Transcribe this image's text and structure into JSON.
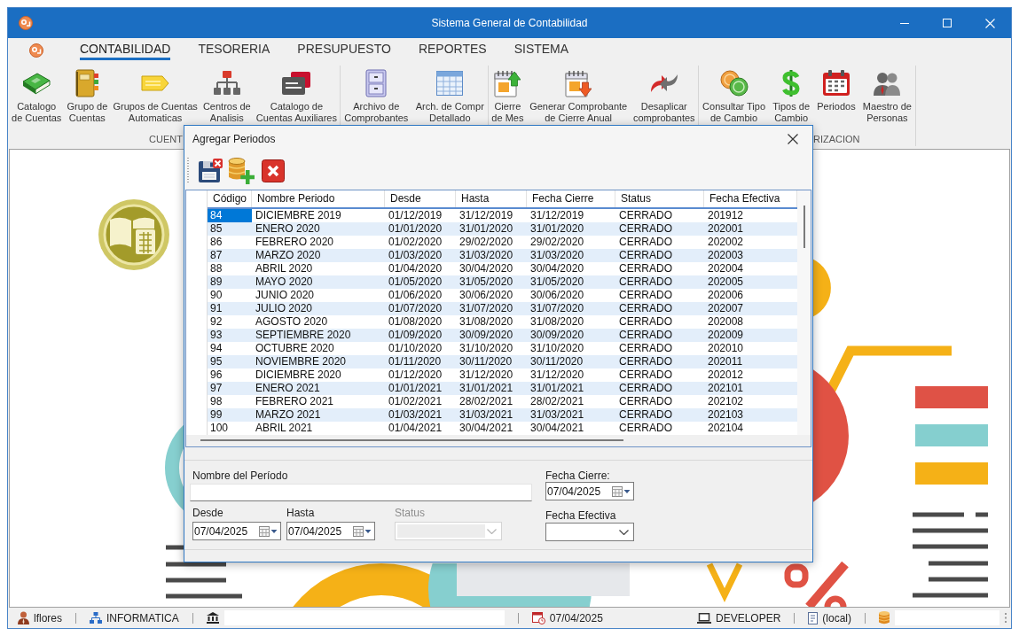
{
  "window": {
    "title": "Sistema General de Contabilidad"
  },
  "menu_tabs": [
    {
      "label": "CONTABILIDAD",
      "selected": true
    },
    {
      "label": "TESORERIA",
      "selected": false
    },
    {
      "label": "PRESUPUESTO",
      "selected": false
    },
    {
      "label": "REPORTES",
      "selected": false
    },
    {
      "label": "SISTEMA",
      "selected": false
    }
  ],
  "ribbon": {
    "groups": [
      {
        "label": "CUENT",
        "buttons": [
          {
            "lines": [
              "Catalogo",
              "de Cuentas"
            ]
          },
          {
            "lines": [
              "Grupo de",
              "Cuentas"
            ]
          },
          {
            "lines": [
              "Grupos de Cuentas",
              "Automaticas"
            ]
          },
          {
            "lines": [
              "Centros de",
              "Analisis"
            ]
          },
          {
            "lines": [
              "Catalogo de",
              "Cuentas Auxiliares"
            ]
          }
        ]
      },
      {
        "buttons": [
          {
            "lines": [
              "Archivo de",
              "Comprobantes"
            ]
          },
          {
            "lines": [
              "Arch. de Compr",
              "Detallado"
            ]
          }
        ]
      },
      {
        "buttons": [
          {
            "lines": [
              "Cierre",
              "de Mes"
            ]
          },
          {
            "lines": [
              "Generar Comprobante",
              "de Cierre Anual"
            ]
          },
          {
            "lines": [
              "Desaplicar",
              "comprobantes"
            ]
          }
        ]
      },
      {
        "label": "RIZACION",
        "buttons": [
          {
            "lines": [
              "Consultar Tipo",
              "de Cambio"
            ]
          },
          {
            "lines": [
              "Tipos de",
              "Cambio"
            ]
          },
          {
            "lines": [
              "Periodos"
            ]
          },
          {
            "lines": [
              "Maestro de",
              "Personas"
            ]
          }
        ]
      }
    ]
  },
  "dialog": {
    "title": "Agregar Periodos",
    "table": {
      "columns": [
        "Código",
        "Nombre Periodo",
        "Desde",
        "Hasta",
        "Fecha Cierre",
        "Status",
        "Fecha Efectiva"
      ],
      "rows": [
        {
          "selected": true,
          "cells": [
            "84",
            "DICIEMBRE 2019",
            "01/12/2019",
            "31/12/2019",
            "31/12/2019",
            "CERRADO",
            "201912"
          ]
        },
        {
          "selected": false,
          "cells": [
            "85",
            "ENERO 2020",
            "01/01/2020",
            "31/01/2020",
            "31/01/2020",
            "CERRADO",
            "202001"
          ]
        },
        {
          "selected": false,
          "cells": [
            "86",
            "FEBRERO 2020",
            "01/02/2020",
            "29/02/2020",
            "29/02/2020",
            "CERRADO",
            "202002"
          ]
        },
        {
          "selected": false,
          "cells": [
            "87",
            "MARZO 2020",
            "01/03/2020",
            "31/03/2020",
            "31/03/2020",
            "CERRADO",
            "202003"
          ]
        },
        {
          "selected": false,
          "cells": [
            "88",
            "ABRIL 2020",
            "01/04/2020",
            "30/04/2020",
            "30/04/2020",
            "CERRADO",
            "202004"
          ]
        },
        {
          "selected": false,
          "cells": [
            "89",
            "MAYO 2020",
            "01/05/2020",
            "31/05/2020",
            "31/05/2020",
            "CERRADO",
            "202005"
          ]
        },
        {
          "selected": false,
          "cells": [
            "90",
            "JUNIO 2020",
            "01/06/2020",
            "30/06/2020",
            "30/06/2020",
            "CERRADO",
            "202006"
          ]
        },
        {
          "selected": false,
          "cells": [
            "91",
            "JULIO 2020",
            "01/07/2020",
            "31/07/2020",
            "31/07/2020",
            "CERRADO",
            "202007"
          ]
        },
        {
          "selected": false,
          "cells": [
            "92",
            "AGOSTO 2020",
            "01/08/2020",
            "31/08/2020",
            "31/08/2020",
            "CERRADO",
            "202008"
          ]
        },
        {
          "selected": false,
          "cells": [
            "93",
            "SEPTIEMBRE 2020",
            "01/09/2020",
            "30/09/2020",
            "30/09/2020",
            "CERRADO",
            "202009"
          ]
        },
        {
          "selected": false,
          "cells": [
            "94",
            "OCTUBRE 2020",
            "01/10/2020",
            "31/10/2020",
            "31/10/2020",
            "CERRADO",
            "202010"
          ]
        },
        {
          "selected": false,
          "cells": [
            "95",
            "NOVIEMBRE 2020",
            "01/11/2020",
            "30/11/2020",
            "30/11/2020",
            "CERRADO",
            "202011"
          ]
        },
        {
          "selected": false,
          "cells": [
            "96",
            "DICIEMBRE 2020",
            "01/12/2020",
            "31/12/2020",
            "31/12/2020",
            "CERRADO",
            "202012"
          ]
        },
        {
          "selected": false,
          "cells": [
            "97",
            "ENERO 2021",
            "01/01/2021",
            "31/01/2021",
            "31/01/2021",
            "CERRADO",
            "202101"
          ]
        },
        {
          "selected": false,
          "cells": [
            "98",
            "FEBRERO 2021",
            "01/02/2021",
            "28/02/2021",
            "28/02/2021",
            "CERRADO",
            "202102"
          ]
        },
        {
          "selected": false,
          "cells": [
            "99",
            "MARZO 2021",
            "01/03/2021",
            "31/03/2021",
            "31/03/2021",
            "CERRADO",
            "202103"
          ]
        },
        {
          "selected": false,
          "cells": [
            "100",
            "ABRIL 2021",
            "01/04/2021",
            "30/04/2021",
            "30/04/2021",
            "CERRADO",
            "202104"
          ]
        }
      ]
    },
    "form": {
      "nombre_del_periodo": {
        "label": "Nombre del Período"
      },
      "fecha_cierre": {
        "label": "Fecha Cierre:",
        "value": "07/04/2025"
      },
      "desde": {
        "label": "Desde",
        "value": "07/04/2025"
      },
      "hasta": {
        "label": "Hasta",
        "value": "07/04/2025"
      },
      "status": {
        "label": "Status",
        "disabled": true
      },
      "fecha_efectiva": {
        "label": "Fecha Efectiva"
      }
    }
  },
  "status_bar": {
    "items": [
      {
        "kind": "text",
        "text": "lflores"
      },
      {
        "kind": "text",
        "text": "INFORMATICA"
      },
      {
        "kind": "field"
      },
      {
        "kind": "text",
        "text": "07/04/2025"
      },
      {
        "kind": "text",
        "text": "DEVELOPER"
      },
      {
        "kind": "text",
        "text": "(local)"
      },
      {
        "kind": "field"
      }
    ]
  }
}
